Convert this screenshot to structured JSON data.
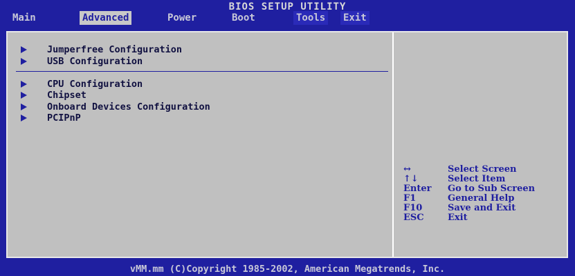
{
  "title": "BIOS SETUP UTILITY",
  "menu": [
    {
      "label": "Main"
    },
    {
      "label": "Advanced"
    },
    {
      "label": "Power"
    },
    {
      "label": "Boot"
    },
    {
      "label": "Tools"
    },
    {
      "label": "Exit"
    }
  ],
  "selected_menu": "Advanced",
  "items": [
    {
      "label": "Jumperfree Configuration"
    },
    {
      "label": "USB Configuration"
    },
    {
      "label": "CPU Configuration"
    },
    {
      "label": "Chipset"
    },
    {
      "label": "Onboard Devices Configuration"
    },
    {
      "label": "PCIPnP"
    }
  ],
  "help": [
    {
      "key": "↔",
      "desc": "Select Screen"
    },
    {
      "key": "↑↓",
      "desc": "Select Item"
    },
    {
      "key": "Enter",
      "desc": "Go to Sub Screen"
    },
    {
      "key": "F1",
      "desc": "General Help"
    },
    {
      "key": "F10",
      "desc": "Save and Exit"
    },
    {
      "key": "ESC",
      "desc": "Exit"
    }
  ],
  "footer": "vMM.mm (C)Copyright 1985-2002, American Megatrends, Inc.",
  "colors": {
    "background": "#1f1fa0",
    "panel": "#c0c0c0",
    "text_dark": "#101040",
    "accent": "#1f1fa0"
  }
}
